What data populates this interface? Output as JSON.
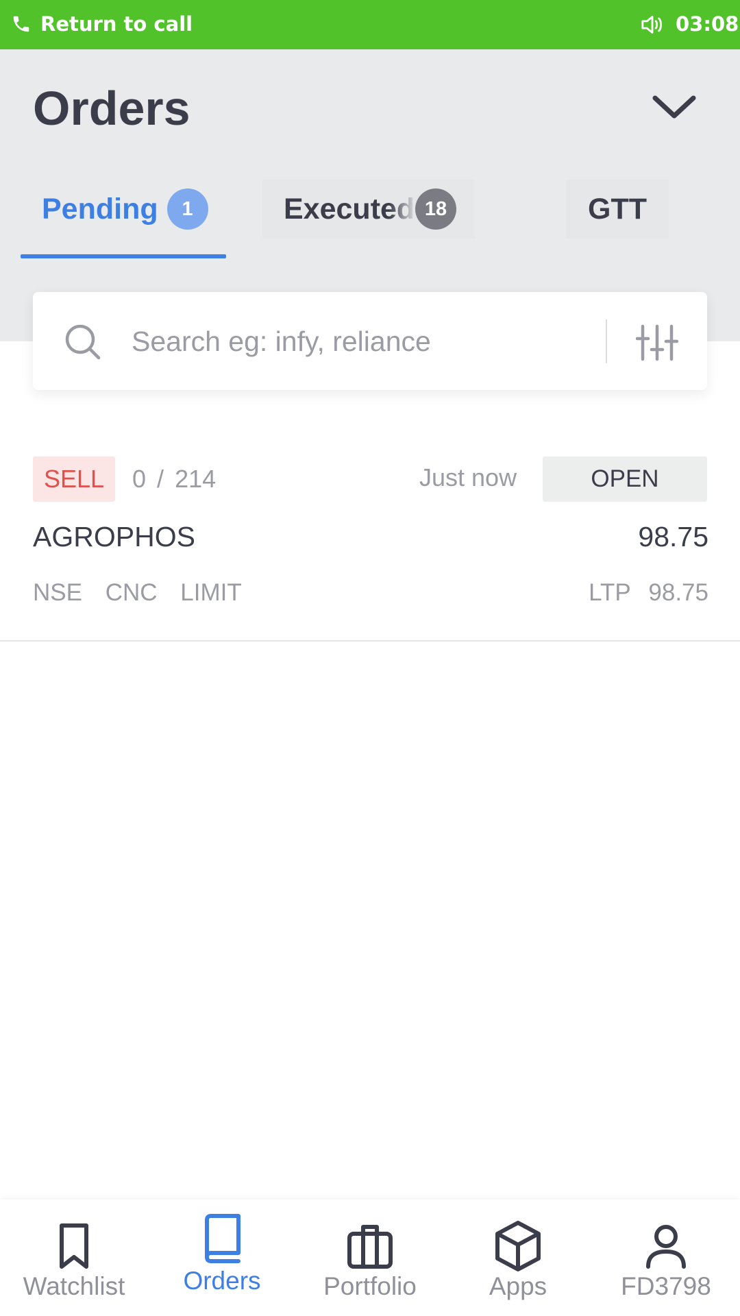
{
  "status_bar": {
    "call_text": "Return to call",
    "time": "03:08",
    "background_color": "#52c22a"
  },
  "header": {
    "title": "Orders",
    "dropdown_icon": "chevron-down-icon"
  },
  "tabs": [
    {
      "label": "Pending",
      "count": "1",
      "active": true
    },
    {
      "label": "Executed",
      "count": "18",
      "active": false
    },
    {
      "label": "GTT",
      "active": false
    }
  ],
  "search": {
    "placeholder": "Search eg: infy, reliance",
    "value": "",
    "search_icon": "search-icon",
    "filter_icon": "sliders-icon"
  },
  "orders": [
    {
      "side": "SELL",
      "filled_qty": "0",
      "total_qty": "214",
      "time": "Just now",
      "status": "OPEN",
      "symbol": "AGROPHOS",
      "price": "98.75",
      "exchange": "NSE",
      "product": "CNC",
      "order_type": "LIMIT",
      "ltp_label": "LTP",
      "ltp": "98.75"
    }
  ],
  "bottom_nav": [
    {
      "label": "Watchlist",
      "icon": "bookmark-icon",
      "active": false
    },
    {
      "label": "Orders",
      "icon": "book-icon",
      "active": true
    },
    {
      "label": "Portfolio",
      "icon": "briefcase-icon",
      "active": false
    },
    {
      "label": "Apps",
      "icon": "cube-icon",
      "active": false
    },
    {
      "label": "FD3798",
      "icon": "user-icon",
      "active": false
    }
  ],
  "colors": {
    "accent": "#3e7fe3",
    "sell": "#e2504d",
    "header_bg": "#e9eaec",
    "text": "#3b3d4a",
    "muted": "#9a9ba3"
  }
}
